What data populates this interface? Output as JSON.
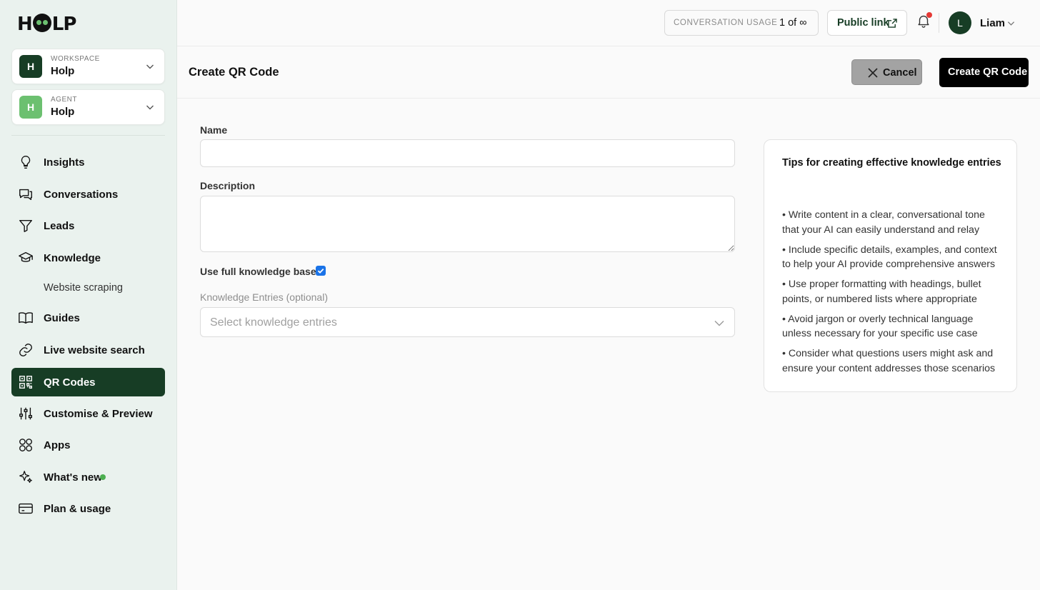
{
  "brand": {
    "logo_text": "HOLP"
  },
  "sidebar": {
    "workspace": {
      "caption": "WORKSPACE",
      "value": "Holp",
      "initial": "H",
      "color": "#173d25"
    },
    "agent": {
      "caption": "AGENT",
      "value": "Holp",
      "initial": "H",
      "color": "#6cc070"
    },
    "items": [
      {
        "label": "Insights",
        "icon": "lightbulb-icon"
      },
      {
        "label": "Conversations",
        "icon": "chat-bubbles-icon"
      },
      {
        "label": "Leads",
        "icon": "funnel-icon"
      },
      {
        "label": "Knowledge",
        "icon": "graduation-cap-icon"
      },
      {
        "label": "Website scraping",
        "icon": null
      },
      {
        "label": "Guides",
        "icon": "book-icon"
      },
      {
        "label": "Live website search",
        "icon": "link-icon"
      },
      {
        "label": "QR Codes",
        "icon": "qr-code-icon",
        "active": true
      },
      {
        "label": "Customise & Preview",
        "icon": "sliders-icon"
      },
      {
        "label": "Apps",
        "icon": "apps-grid-icon"
      },
      {
        "label": "What's new",
        "icon": "sparkles-icon"
      },
      {
        "label": "Plan & usage",
        "icon": "credit-card-icon"
      }
    ]
  },
  "topbar": {
    "usage_caption": "CONVERSATION USAGE",
    "usage_value": "1 of ∞",
    "public_link_label": "Public link",
    "user_initial": "L",
    "user_name": "Liam"
  },
  "page": {
    "title": "Create QR Code",
    "cancel_label": "Cancel",
    "create_label": "Create QR Code"
  },
  "form": {
    "name_label": "Name",
    "name_value": "",
    "description_label": "Description",
    "description_value": "",
    "use_full_kb_label": "Use full knowledge base",
    "use_full_kb_checked": true,
    "entries_label": "Knowledge Entries (optional)",
    "entries_placeholder": "Select knowledge entries"
  },
  "tips": {
    "title": "Tips for creating effective knowledge entries",
    "items": [
      "• Write content in a clear, conversational tone that your AI can easily understand and relay",
      "• Include specific details, examples, and context to help your AI provide comprehensive answers",
      "• Use proper formatting with headings, bullet points, or numbered lists where appropriate",
      "• Avoid jargon or overly technical language unless necessary for your specific use case",
      "• Consider what questions users might ask and ensure your content addresses those scenarios"
    ]
  },
  "colors": {
    "sidebar_bg": "#eaf2ee",
    "active_nav": "#173d25",
    "brand_green": "#6cc070",
    "notification_dot": "#e53935",
    "new_dot": "#4caf50",
    "primary_button": "#000000",
    "checkbox": "#1a73e8"
  }
}
